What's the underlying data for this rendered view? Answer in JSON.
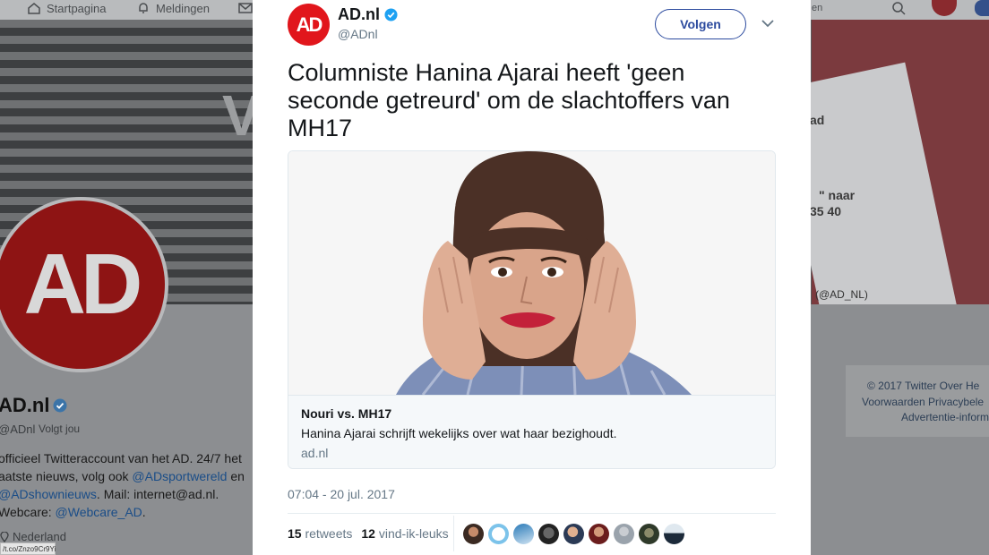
{
  "background": {
    "nav": {
      "home_label": "Startpagina",
      "notifications_label": "Meldingen",
      "search_fragment": "en"
    },
    "banner": {
      "letter": "V",
      "card_text_1": "ad",
      "card_text_2": "\" naar",
      "card_text_3": "35 40",
      "card_handle": "(@AD_NL)"
    },
    "profile": {
      "avatar_text": "AD",
      "name": "AD.nl",
      "handle": "@ADnl",
      "follows_you": "Volgt jou",
      "bio_1": "officieel Twitteraccount van het AD. 24/7 het",
      "bio_2a": "aatste nieuws, volg ook ",
      "bio_2_link": "@ADsportwereld",
      "bio_2b": " en",
      "bio_3_link": "@ADshownieuws",
      "bio_3b": ". Mail: internet@ad.nl.",
      "bio_4a": "Webcare: ",
      "bio_4_link": "@Webcare_AD",
      "bio_4b": ".",
      "location": "Nederland",
      "status_url": "/t.co/Znzo9Cr9Yi"
    },
    "footer": {
      "line1": "© 2017 Twitter   Over   He",
      "line2": "Voorwaarden   Privacybele",
      "line3": "Advertentie-informa"
    }
  },
  "tweet": {
    "author_name": "AD.nl",
    "author_handle": "@ADnl",
    "avatar_text": "AD",
    "follow_label": "Volgen",
    "text": "Columniste Hanina Ajarai heeft 'geen seconde getreurd' om de slachtoffers van MH17",
    "card": {
      "title": "Nouri vs. MH17",
      "description": "Hanina Ajarai schrijft wekelijks over wat haar bezighoudt.",
      "domain": "ad.nl"
    },
    "timestamp": "07:04 - 20 jul. 2017",
    "retweets_count": "15",
    "retweets_label": "retweets",
    "likes_count": "12",
    "likes_label": "vind-ik-leuks"
  },
  "colors": {
    "brand_red": "#e1161c",
    "link_blue": "#2b4a9e",
    "verified_blue": "#1da1f2"
  },
  "icons": [
    "home-icon",
    "bell-icon",
    "mail-icon",
    "search-icon",
    "verified-icon",
    "chevron-down-icon",
    "location-icon"
  ]
}
